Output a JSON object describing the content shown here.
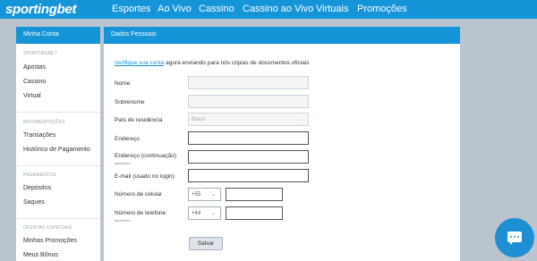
{
  "brand": {
    "logo_main": "sporting",
    "logo_accent": "bet"
  },
  "nav": {
    "items": [
      "Esportes",
      "Ao Vivo",
      "Cassino",
      "Cassino ao Vivo",
      "Virtuais",
      "Promoções"
    ]
  },
  "sidebar": {
    "title": "Minha Conta",
    "sections": [
      {
        "heading": "SPORTINGBET",
        "items": [
          "Apostas",
          "Cassino",
          "Virtual"
        ]
      },
      {
        "heading": "MOVIMENTAÇÕES",
        "items": [
          "Transações",
          "Histórico de Pagamento"
        ]
      },
      {
        "heading": "PAGAMENTOS",
        "items": [
          "Depósitos",
          "Saques"
        ]
      },
      {
        "heading": "OFERTAS ESPECIAIS",
        "items": [
          "Minhas Promoções",
          "Meus Bônus"
        ]
      }
    ]
  },
  "main": {
    "title": "Dados Pessoais",
    "verify_link": "Verifique sua conta",
    "verify_text": " agora enviando para nós cópias de documentos oficiais",
    "fields": {
      "nome": "Nome",
      "sobrenome": "Sobrenome",
      "pais": "País de residência",
      "pais_value": "Brasil",
      "endereco": "Endereço",
      "endereco2": "Endereço (continuação)",
      "endereco2_sub": "facultativo",
      "email": "E-mail (usado no login)",
      "celular": "Número de celular",
      "celular_code": "+55",
      "telefone": "Número de telefone",
      "telefone_code": "+44",
      "telefone_sub": "facultativo"
    },
    "save_label": "Salvar"
  },
  "icons": {
    "chat": "chat-icon",
    "dropdown": "chevron-down-icon"
  },
  "colors": {
    "brand_blue": "#1594d8",
    "background": "#b9c4cf"
  }
}
